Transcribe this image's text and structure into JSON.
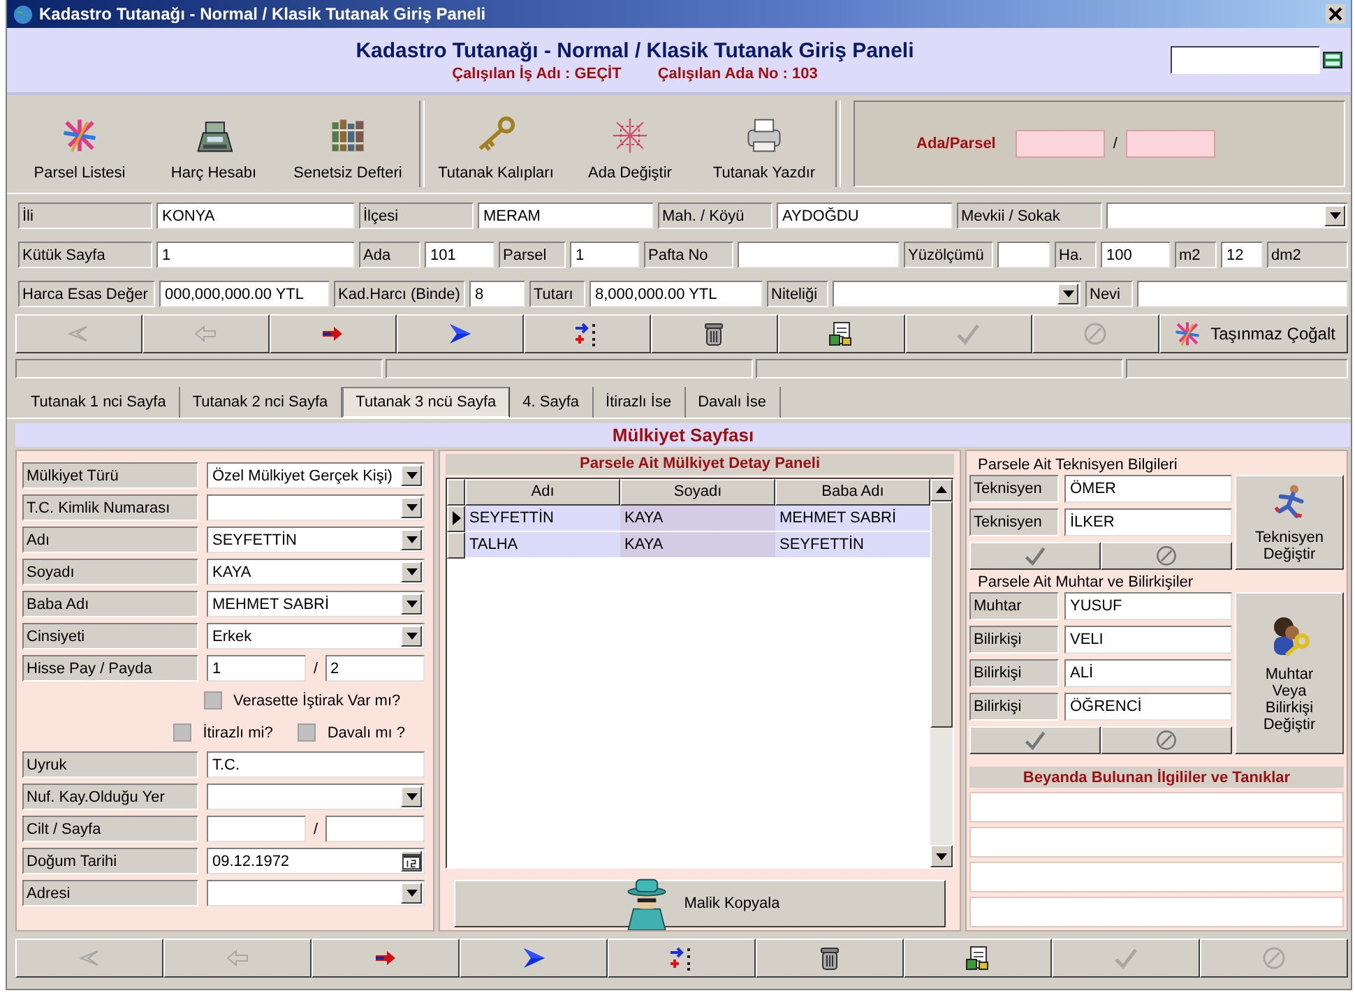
{
  "window": {
    "title": "Kadastro Tutanağı - Normal / Klasik Tutanak Giriş Paneli"
  },
  "header": {
    "title": "Kadastro Tutanağı - Normal / Klasik Tutanak Giriş Paneli",
    "job": "Çalışılan İş Adı : GEÇİT",
    "ada_no": "Çalışılan Ada No : 103"
  },
  "toolbar": [
    {
      "label": "Parsel Listesi"
    },
    {
      "label": "Harç Hesabı"
    },
    {
      "label": "Senetsiz Defteri"
    },
    {
      "label": "Tutanak Kalıpları"
    },
    {
      "label": "Ada Değiştir"
    },
    {
      "label": "Tutanak Yazdır"
    }
  ],
  "ada_parsel": {
    "label": "Ada/Parsel",
    "separator": "/"
  },
  "fields": [
    [
      {
        "kind": "label",
        "text": "İli"
      },
      {
        "kind": "input",
        "value": "KONYA"
      },
      {
        "kind": "label",
        "text": "İlçesi"
      },
      {
        "kind": "input",
        "value": "MERAM"
      },
      {
        "kind": "label",
        "text": "Mah. / Köyü"
      },
      {
        "kind": "input",
        "value": "AYDOĞDU"
      },
      {
        "kind": "label",
        "text": "Mevkii / Sokak"
      },
      {
        "kind": "select"
      }
    ],
    [
      {
        "kind": "label",
        "text": "Kütük Sayfa"
      },
      {
        "kind": "input",
        "value": "1"
      },
      {
        "kind": "label",
        "text": "Ada"
      },
      {
        "kind": "input",
        "value": "101"
      },
      {
        "kind": "label",
        "text": "Parsel"
      },
      {
        "kind": "input",
        "value": "1"
      },
      {
        "kind": "label",
        "text": "Pafta No"
      },
      {
        "kind": "input"
      },
      {
        "kind": "label",
        "text": "Yüzölçümü"
      },
      {
        "kind": "input"
      },
      {
        "kind": "label",
        "text": "Ha."
      },
      {
        "kind": "input",
        "value": "100"
      },
      {
        "kind": "label",
        "text": "m2"
      },
      {
        "kind": "input",
        "value": "12"
      },
      {
        "kind": "label",
        "text": "dm2"
      }
    ],
    [
      {
        "kind": "label",
        "text": "Harca Esas Değer"
      },
      {
        "kind": "input",
        "value": "000,000,000.00 YTL"
      },
      {
        "kind": "label",
        "text": "Kad.Harcı (Binde)"
      },
      {
        "kind": "input",
        "value": "8"
      },
      {
        "kind": "label",
        "text": "Tutarı"
      },
      {
        "kind": "input",
        "value": "8,000,000.00 YTL"
      },
      {
        "kind": "label",
        "text": "Niteliği"
      },
      {
        "kind": "select"
      },
      {
        "kind": "label",
        "text": "Nevi"
      },
      {
        "kind": "input"
      }
    ]
  ],
  "nav_top": {
    "buttons": [
      {
        "disabled": true
      },
      {
        "disabled": true
      },
      {
        "disabled": false
      },
      {
        "disabled": false
      },
      {
        "disabled": false
      },
      {
        "disabled": false
      },
      {
        "disabled": false
      },
      {
        "disabled": true
      },
      {
        "disabled": true
      }
    ],
    "extra": {
      "label": "Taşınmaz Çoğalt"
    }
  },
  "tabs": [
    {
      "label": "Tutanak 1 nci Sayfa",
      "selected": false
    },
    {
      "label": "Tutanak 2 nci Sayfa",
      "selected": false
    },
    {
      "label": "Tutanak 3 ncü Sayfa",
      "selected": true
    },
    {
      "label": "4. Sayfa",
      "selected": false
    },
    {
      "label": "İtirazlı İse",
      "selected": false
    },
    {
      "label": "Davalı İse",
      "selected": false
    }
  ],
  "section_title": "Mülkiyet Sayfası",
  "owner_form": [
    {
      "kind": "select",
      "label": "Mülkiyet Türü",
      "value": "Özel Mülkiyet Gerçek Kişi)"
    },
    {
      "kind": "select",
      "label": "T.C. Kimlik Numarası"
    },
    {
      "kind": "select",
      "label": "Adı",
      "value": "SEYFETTİN"
    },
    {
      "kind": "select",
      "label": "Soyadı",
      "value": "KAYA"
    },
    {
      "kind": "select",
      "label": "Baba Adı",
      "value": "MEHMET SABRİ"
    },
    {
      "kind": "select",
      "label": "Cinsiyeti",
      "value": "Erkek"
    },
    {
      "kind": "pair",
      "label": "Hisse Pay / Payda",
      "values": [
        "1",
        "2"
      ],
      "separator": "/"
    },
    {
      "kind": "checks",
      "items": [
        {
          "label": "Verasette İştirak Var mı?",
          "checked": false
        }
      ]
    },
    {
      "kind": "checks",
      "items": [
        {
          "label": "İtirazlı mi?",
          "checked": false
        },
        {
          "label": "Davalı mı ?",
          "checked": false
        }
      ]
    },
    {
      "kind": "input",
      "label": "Uyruk",
      "value": "T.C."
    },
    {
      "kind": "select",
      "label": "Nuf. Kay.Olduğu Yer"
    },
    {
      "kind": "pair",
      "label": "Cilt / Sayfa",
      "separator": "/"
    },
    {
      "kind": "date",
      "label": "Doğum Tarihi",
      "value": "09.12.1972"
    },
    {
      "kind": "select",
      "label": "Adresi"
    }
  ],
  "owners_panel": {
    "title": "Parsele Ait Mülkiyet Detay Paneli",
    "columns": [
      "Adı",
      "Soyadı",
      "Baba Adı"
    ],
    "rows": [
      {
        "selected": true,
        "cells": [
          "SEYFETTİN",
          "KAYA",
          "MEHMET SABRİ"
        ]
      },
      {
        "selected": false,
        "cells": [
          "TALHA",
          "KAYA",
          "SEYFETTİN"
        ]
      }
    ],
    "copy_button": "Malik Kopyala"
  },
  "technicians": {
    "title": "Parsele Ait Teknisyen Bilgileri",
    "fields": [
      {
        "label": "Teknisyen",
        "value": "ÖMER"
      },
      {
        "label": "Teknisyen",
        "value": "İLKER"
      }
    ],
    "change_button": "Teknisyen Değiştir"
  },
  "experts": {
    "title": "Parsele Ait Muhtar ve Bilirkişiler",
    "fields": [
      {
        "label": "Muhtar",
        "value": "YUSUF"
      },
      {
        "label": "Bilirkişi",
        "value": "VELI"
      },
      {
        "label": "Bilirkişi",
        "value": "ALİ"
      },
      {
        "label": "Bilirkişi",
        "value": "ÖĞRENCİ"
      }
    ],
    "change_button": "Muhtar Veya Bilirkişi Değiştir"
  },
  "declarants": {
    "title": "Beyanda Bulunan İlgililer ve Tanıklar"
  },
  "nav_bottom": {
    "buttons": [
      {
        "disabled": true
      },
      {
        "disabled": true
      },
      {
        "disabled": false
      },
      {
        "disabled": false
      },
      {
        "disabled": false
      },
      {
        "disabled": false
      },
      {
        "disabled": false
      },
      {
        "disabled": true
      },
      {
        "disabled": true
      }
    ]
  }
}
